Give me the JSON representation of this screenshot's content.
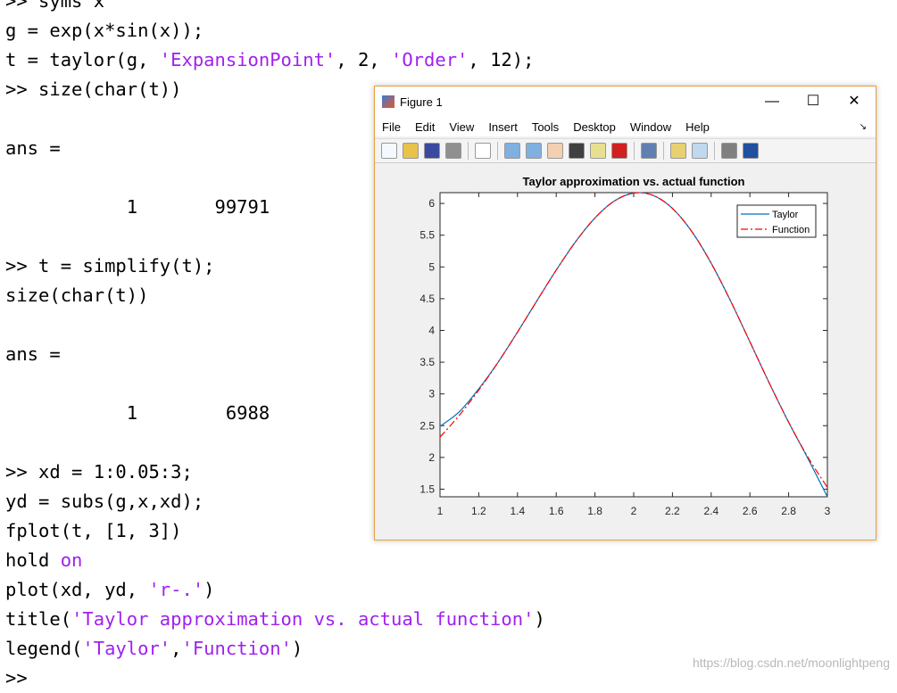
{
  "command_window": {
    "lines": [
      [
        {
          "t": ">> syms x"
        }
      ],
      [
        {
          "t": "g = exp(x*sin(x));"
        }
      ],
      [
        {
          "t": "t = taylor(g, "
        },
        {
          "t": "'ExpansionPoint'",
          "s": 1
        },
        {
          "t": ", 2, "
        },
        {
          "t": "'Order'",
          "s": 1
        },
        {
          "t": ", 12);"
        }
      ],
      [
        {
          "t": ">> size(char(t))"
        }
      ],
      [
        {
          "t": ""
        }
      ],
      [
        {
          "t": "ans ="
        }
      ],
      [
        {
          "t": ""
        }
      ],
      [
        {
          "t": "           1       99791"
        }
      ],
      [
        {
          "t": ""
        }
      ],
      [
        {
          "t": ">> t = simplify(t);"
        }
      ],
      [
        {
          "t": "size(char(t))"
        }
      ],
      [
        {
          "t": ""
        }
      ],
      [
        {
          "t": "ans ="
        }
      ],
      [
        {
          "t": ""
        }
      ],
      [
        {
          "t": "           1        6988"
        }
      ],
      [
        {
          "t": ""
        }
      ],
      [
        {
          "t": ">> xd = 1:0.05:3;"
        }
      ],
      [
        {
          "t": "yd = subs(g,x,xd);"
        }
      ],
      [
        {
          "t": "fplot(t, [1, 3])"
        }
      ],
      [
        {
          "t": "hold "
        },
        {
          "t": "on",
          "s": 1
        }
      ],
      [
        {
          "t": "plot(xd, yd, "
        },
        {
          "t": "'r-.'",
          "s": 1
        },
        {
          "t": ")"
        }
      ],
      [
        {
          "t": "title("
        },
        {
          "t": "'Taylor approximation vs. actual function'",
          "s": 1
        },
        {
          "t": ")"
        }
      ],
      [
        {
          "t": "legend("
        },
        {
          "t": "'Taylor'",
          "s": 1
        },
        {
          "t": ","
        },
        {
          "t": "'Function'",
          "s": 1
        },
        {
          "t": ")"
        }
      ],
      [
        {
          "t": ">>"
        }
      ]
    ]
  },
  "figure": {
    "title": "Figure 1",
    "controls": {
      "minimize": "—",
      "maximize": "☐",
      "close": "✕"
    },
    "menu": [
      "File",
      "Edit",
      "View",
      "Insert",
      "Tools",
      "Desktop",
      "Window",
      "Help"
    ],
    "dock_icon": "↘",
    "toolbar": [
      {
        "name": "new-figure-icon",
        "color": "#f4f8ff"
      },
      {
        "name": "open-file-icon",
        "color": "#e8c24a"
      },
      {
        "name": "save-icon",
        "color": "#3a4aa0"
      },
      {
        "name": "print-icon",
        "color": "#909090"
      },
      {
        "sep": true
      },
      {
        "name": "edit-plot-arrow-icon",
        "color": "#ffffff"
      },
      {
        "sep": true
      },
      {
        "name": "zoom-in-icon",
        "color": "#7fb0e0"
      },
      {
        "name": "zoom-out-icon",
        "color": "#7fb0e0"
      },
      {
        "name": "pan-hand-icon",
        "color": "#f2d0b0"
      },
      {
        "name": "rotate-3d-icon",
        "color": "#404040"
      },
      {
        "name": "data-cursor-icon",
        "color": "#e8e090"
      },
      {
        "name": "brush-icon",
        "color": "#d02020"
      },
      {
        "sep": true
      },
      {
        "name": "link-plot-icon",
        "color": "#6080b0"
      },
      {
        "sep": true
      },
      {
        "name": "colorbar-icon",
        "color": "#e8d070"
      },
      {
        "name": "legend-icon",
        "color": "#c0d8f0"
      },
      {
        "sep": true
      },
      {
        "name": "hide-plot-tools-icon",
        "color": "#808080"
      },
      {
        "name": "show-plot-tools-icon",
        "color": "#2050a0"
      }
    ]
  },
  "chart_data": {
    "type": "line",
    "title": "Taylor approximation vs. actual function",
    "xlim": [
      1,
      3
    ],
    "ylim": [
      1.38,
      6.17
    ],
    "xticks": [
      "1",
      "1.2",
      "1.4",
      "1.6",
      "1.8",
      "2",
      "2.2",
      "2.4",
      "2.6",
      "2.8",
      "3"
    ],
    "yticks": [
      "1.5",
      "2",
      "2.5",
      "3",
      "3.5",
      "4",
      "4.5",
      "5",
      "5.5",
      "6"
    ],
    "legend_position": "top-right",
    "x": [
      1,
      1.1,
      1.2,
      1.3,
      1.4,
      1.5,
      1.6,
      1.7,
      1.8,
      1.9,
      2.0,
      2.1,
      2.2,
      2.3,
      2.4,
      2.5,
      2.6,
      2.7,
      2.8,
      2.9,
      3.0
    ],
    "series": [
      {
        "name": "Taylor",
        "color": "#0072bd",
        "style": "solid",
        "values": [
          2.49,
          2.72,
          3.08,
          3.5,
          3.973,
          4.465,
          4.95,
          5.397,
          5.771,
          6.038,
          6.163,
          6.127,
          5.922,
          5.557,
          5.059,
          4.465,
          3.82,
          3.171,
          2.553,
          1.98,
          1.38
        ]
      },
      {
        "name": "Function",
        "color": "#ff0000",
        "style": "dashdot",
        "values": [
          2.32,
          2.665,
          3.06,
          3.499,
          3.973,
          4.465,
          4.95,
          5.397,
          5.771,
          6.038,
          6.163,
          6.127,
          5.922,
          5.557,
          5.059,
          4.465,
          3.82,
          3.171,
          2.555,
          2.001,
          1.527
        ]
      }
    ]
  },
  "watermark": "https://blog.csdn.net/moonlightpeng"
}
